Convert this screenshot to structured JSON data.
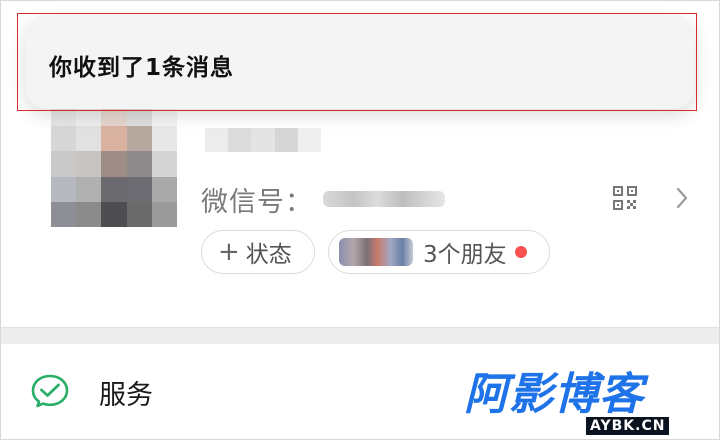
{
  "notification": {
    "message": "你收到了1条消息"
  },
  "profile": {
    "wechat_id_label": "微信号：",
    "status_pill": {
      "plus_glyph": "+",
      "label": "状态"
    },
    "friends_pill": {
      "label": "3个朋友",
      "unread_dot_color": "#fa5151"
    },
    "icons": [
      "qr-code-icon",
      "chevron-right-icon"
    ]
  },
  "menu": {
    "items": [
      {
        "label": "服务",
        "icon": "service-wallet-icon",
        "icon_color": "#2aae67"
      }
    ]
  },
  "watermark": {
    "text_main": "阿影博客",
    "text_sub": "AYBK.CN",
    "color": "#1e73e8"
  }
}
